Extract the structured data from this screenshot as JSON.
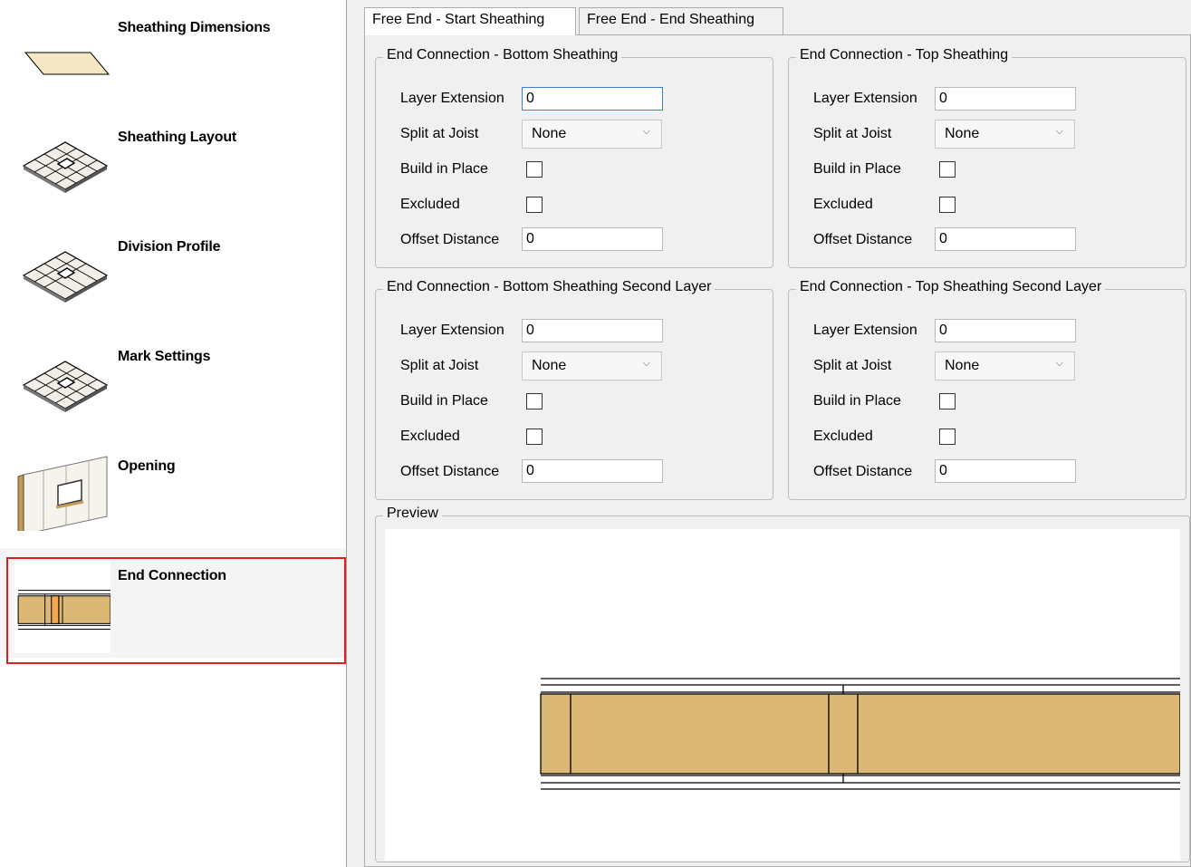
{
  "sidebar": {
    "items": [
      {
        "label": "Sheathing Dimensions"
      },
      {
        "label": "Sheathing Layout"
      },
      {
        "label": "Division Profile"
      },
      {
        "label": "Mark Settings"
      },
      {
        "label": "Opening"
      },
      {
        "label": "End Connection"
      }
    ],
    "selected_index": 5
  },
  "tabs": [
    {
      "label": "Free End - Start Sheathing",
      "active": true
    },
    {
      "label": "Free End - End Sheathing",
      "active": false
    }
  ],
  "groups": [
    {
      "title": "End Connection - Bottom Sheathing",
      "layer_extension_label": "Layer Extension",
      "layer_extension_value": "0",
      "split_label": "Split at Joist",
      "split_value": "None",
      "build_label": "Build in Place",
      "build_checked": false,
      "excluded_label": "Excluded",
      "excluded_checked": false,
      "offset_label": "Offset Distance",
      "offset_value": "0"
    },
    {
      "title": "End Connection - Top Sheathing",
      "layer_extension_label": "Layer Extension",
      "layer_extension_value": "0",
      "split_label": "Split at Joist",
      "split_value": "None",
      "build_label": "Build in Place",
      "build_checked": false,
      "excluded_label": "Excluded",
      "excluded_checked": false,
      "offset_label": "Offset Distance",
      "offset_value": "0"
    },
    {
      "title": "End Connection - Bottom Sheathing Second Layer",
      "layer_extension_label": "Layer Extension",
      "layer_extension_value": "0",
      "split_label": "Split at Joist",
      "split_value": "None",
      "build_label": "Build in Place",
      "build_checked": false,
      "excluded_label": "Excluded",
      "excluded_checked": false,
      "offset_label": "Offset Distance",
      "offset_value": "0"
    },
    {
      "title": "End Connection -  Top Sheathing Second Layer",
      "layer_extension_label": "Layer Extension",
      "layer_extension_value": "0",
      "split_label": "Split at Joist",
      "split_value": "None",
      "build_label": "Build in Place",
      "build_checked": false,
      "excluded_label": "Excluded",
      "excluded_checked": false,
      "offset_label": "Offset Distance",
      "offset_value": "0"
    }
  ],
  "preview": {
    "title": "Preview"
  },
  "colors": {
    "wood": "#dcb877",
    "selection_outline": "#e02020",
    "sheet_face": "#f5e6c4",
    "focus_border": "#3c7fd6"
  }
}
